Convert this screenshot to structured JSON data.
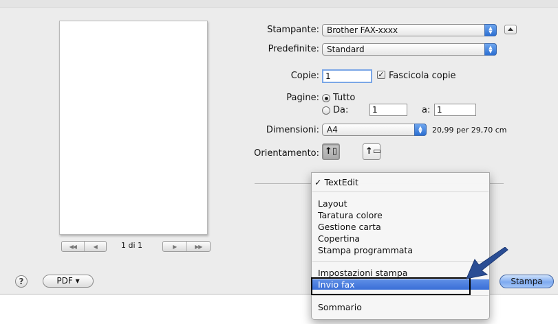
{
  "printer": {
    "label": "Stampante:",
    "value": "Brother FAX-xxxx"
  },
  "presets": {
    "label": "Predefinite:",
    "value": "Standard"
  },
  "copies": {
    "label": "Copie:",
    "value": "1",
    "collate_label": "Fascicola copie",
    "collate_checked": true
  },
  "pages": {
    "label": "Pagine:",
    "all_label": "Tutto",
    "from_label": "Da:",
    "from_value": "1",
    "to_label": "a:",
    "to_value": "1"
  },
  "paper_size": {
    "label": "Dimensioni:",
    "value": "A4",
    "dimensions": "20,99 per 29,70 cm"
  },
  "orientation": {
    "label": "Orientamento:",
    "selected": "portrait"
  },
  "preview": {
    "page_indicator": "1 di 1",
    "nav_first": "◀◀",
    "nav_prev": "◀",
    "nav_next": "▶",
    "nav_last": "▶▶"
  },
  "popup_menu": {
    "checked_item": "✓ TextEdit",
    "items": [
      "Layout",
      "Taratura colore",
      "Gestione carta",
      "Copertina",
      "Stampa programmata"
    ],
    "settings_item": "Impostazioni stampa",
    "highlighted_item": "Invio fax",
    "summary_item": "Sommario"
  },
  "bottom_bar": {
    "help": "?",
    "pdf_label": "PDF ▾",
    "print_label": "Stampa"
  },
  "icons": {
    "popup_arrows": "updown-arrows-icon",
    "collapse": "triangle-up-icon",
    "annotation_arrow": "arrow-icon"
  },
  "colors": {
    "highlight": "#3a6fd7",
    "accent_button": "#7eaaf0",
    "annotation_arrow": "#2a4d94"
  }
}
